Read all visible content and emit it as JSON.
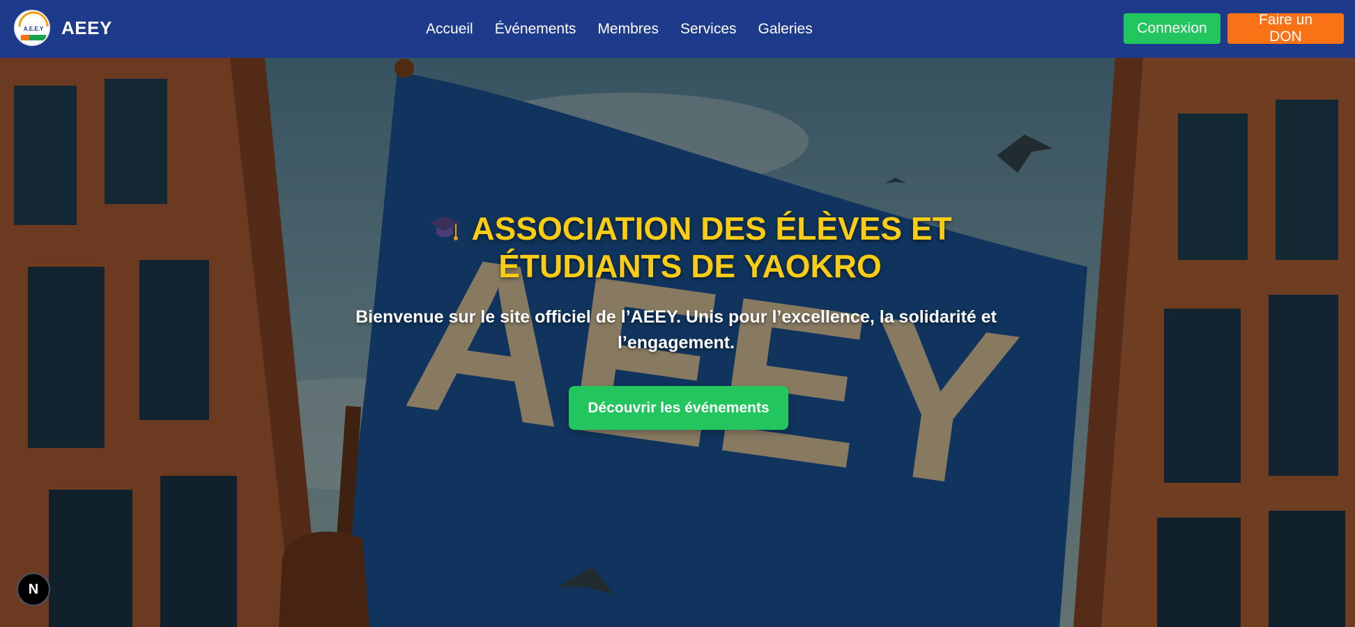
{
  "brand": {
    "name": "AEEY",
    "logo_text": "A.E.E.Y"
  },
  "nav": {
    "links": [
      {
        "label": "Accueil"
      },
      {
        "label": "Événements"
      },
      {
        "label": "Membres"
      },
      {
        "label": "Services"
      },
      {
        "label": "Galeries"
      }
    ],
    "login_label": "Connexion",
    "donate_label": "Faire un DON"
  },
  "hero": {
    "title_icon": "graduation-cap-icon",
    "title_line1": "ASSOCIATION DES ÉLÈVES ET",
    "title_line2": "ÉTUDIANTS DE YAOKRO",
    "subtitle": "Bienvenue sur le site officiel de l’AEEY. Unis pour l’excellence, la solidarité et l’engagement.",
    "cta_label": "Découvrir les événements",
    "flag_text": "AEEY"
  },
  "dev_badge": {
    "label": "N"
  },
  "colors": {
    "navbar": "#1e3a8a",
    "title": "#facc15",
    "login": "#22c55e",
    "donate": "#f97316",
    "cta": "#22c55e"
  }
}
